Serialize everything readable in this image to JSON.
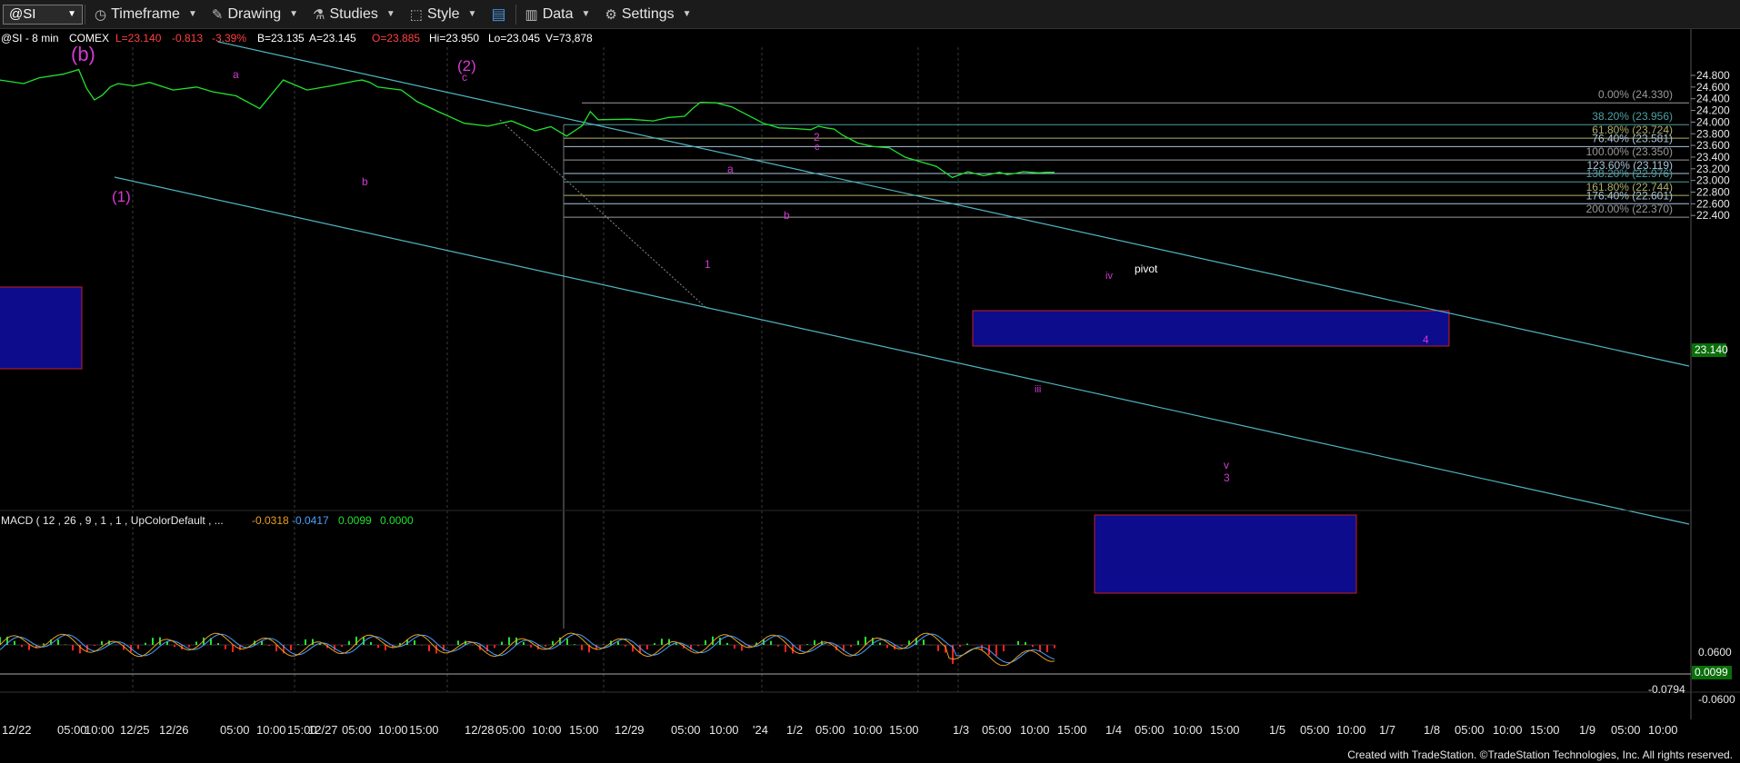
{
  "toolbar": {
    "symbol": "@SI",
    "items": [
      "Timeframe",
      "Drawing",
      "Studies",
      "Style",
      "Data",
      "Settings"
    ]
  },
  "header": {
    "symbol": "@SI - 8 min",
    "exchange": "COMEX",
    "last": "L=23.140",
    "change": "-0.813",
    "pct": "-3.39%",
    "bid": "B=23.135",
    "ask": "A=23.145",
    "open": "O=23.885",
    "high": "Hi=23.950",
    "low": "Lo=23.045",
    "volume": "V=73,878"
  },
  "colors": {
    "price": "#22e22e",
    "wave_label": "#d33ad3",
    "channel": "#4fb6c4",
    "box_fill": "#0c0c8c",
    "box_border": "#c81e1e",
    "last_badge": "#0a6e0a"
  },
  "chart_data": [
    {
      "type": "line",
      "title": "@SI - 8 min",
      "y_axis_ticks": [
        "24.800",
        "24.600",
        "24.400",
        "24.200",
        "24.000",
        "23.800",
        "23.600",
        "23.400",
        "23.200",
        "23.000",
        "22.800",
        "22.600",
        "22.400"
      ],
      "ylim": [
        22.25,
        24.95
      ],
      "last_price": "23.140",
      "x_tick_labels": [
        "12/22",
        "05:00",
        "10:00",
        "12/25",
        "12/26",
        "05:00",
        "10:00",
        "15:00",
        "12/27",
        "05:00",
        "10:00",
        "15:00",
        "12/28",
        "05:00",
        "10:00",
        "15:00",
        "12/29",
        "05:00",
        "10:00",
        "'24",
        "1/2",
        "05:00",
        "10:00",
        "15:00",
        "1/3",
        "05:00",
        "10:00",
        "15:00",
        "1/4",
        "05:00",
        "10:00",
        "15:00",
        "1/5",
        "05:00",
        "10:00",
        "1/7",
        "1/8",
        "05:00",
        "10:00",
        "15:00",
        "1/9",
        "05:00",
        "10:00"
      ],
      "series": [
        {
          "x": [
            0,
            3,
            5,
            8,
            10,
            11,
            12,
            13,
            14,
            15,
            17,
            19,
            22,
            25,
            27,
            30,
            33,
            36,
            39,
            42,
            45,
            46,
            47,
            48,
            51,
            53,
            56,
            59,
            62,
            65,
            68,
            70,
            72,
            74,
            75,
            76,
            80,
            83,
            85,
            87,
            88,
            89,
            91,
            93,
            95,
            97,
            99,
            101,
            103,
            104,
            105,
            106,
            107,
            109,
            111,
            113,
            115,
            117,
            119,
            121,
            123,
            125,
            127,
            128,
            129,
            130,
            131,
            132,
            133,
            134
          ],
          "values": [
            24.72,
            24.66,
            24.76,
            24.82,
            24.9,
            24.58,
            24.38,
            24.46,
            24.6,
            24.66,
            24.62,
            24.68,
            24.55,
            24.6,
            24.52,
            24.45,
            24.23,
            24.72,
            24.55,
            24.62,
            24.7,
            24.72,
            24.68,
            24.6,
            24.55,
            24.35,
            24.16,
            23.98,
            23.93,
            24.02,
            23.85,
            23.92,
            23.76,
            23.94,
            24.18,
            24.04,
            24.05,
            24.02,
            24.08,
            24.1,
            24.23,
            24.34,
            24.33,
            24.26,
            24.12,
            23.98,
            23.9,
            23.89,
            23.87,
            23.93,
            23.9,
            23.88,
            23.78,
            23.64,
            23.58,
            23.56,
            23.4,
            23.32,
            23.24,
            23.05,
            23.15,
            23.08,
            23.14,
            23.1,
            23.12,
            23.15,
            23.14,
            23.13,
            23.14,
            23.14
          ]
        }
      ],
      "fib_levels": [
        {
          "pct": "0.00%",
          "value": "24.330",
          "color": "#9a9a9a"
        },
        {
          "pct": "38.20%",
          "value": "23.956",
          "color": "#4fa0a0"
        },
        {
          "pct": "61.80%",
          "value": "23.724",
          "color": "#b0b06a"
        },
        {
          "pct": "76.40%",
          "value": "23.581",
          "color": "#a8c4dc"
        },
        {
          "pct": "100.00%",
          "value": "23.350",
          "color": "#9a9a9a"
        },
        {
          "pct": "123.60%",
          "value": "23.119",
          "color": "#a8c4dc"
        },
        {
          "pct": "138.20%",
          "value": "22.976",
          "color": "#4fa0a0"
        },
        {
          "pct": "161.80%",
          "value": "22.744",
          "color": "#b0b06a"
        },
        {
          "pct": "176.40%",
          "value": "22.601",
          "color": "#a8c4dc"
        },
        {
          "pct": "200.00%",
          "value": "22.370",
          "color": "#9a9a9a"
        }
      ],
      "wave_labels": [
        "(b)",
        "(1)",
        "(2)",
        "a",
        "b",
        "c",
        "1",
        "2",
        "c",
        "a",
        "b",
        "iii",
        "iv",
        "pivot",
        "4",
        "v",
        "3"
      ]
    },
    {
      "type": "line",
      "title": "MACD ( 12 , 26 , 9 , 1 , 1 , UpColorDefault , ...",
      "values_text": [
        "-0.0318",
        "-0.0417",
        "0.0099",
        "0.0000"
      ],
      "y_axis_ticks": [
        "0.0600",
        "-0.0600"
      ],
      "last_value": "0.0099",
      "low_marker": "-0.0794"
    }
  ],
  "footer": "Created with TradeStation. ©TradeStation Technologies, Inc. All rights reserved."
}
